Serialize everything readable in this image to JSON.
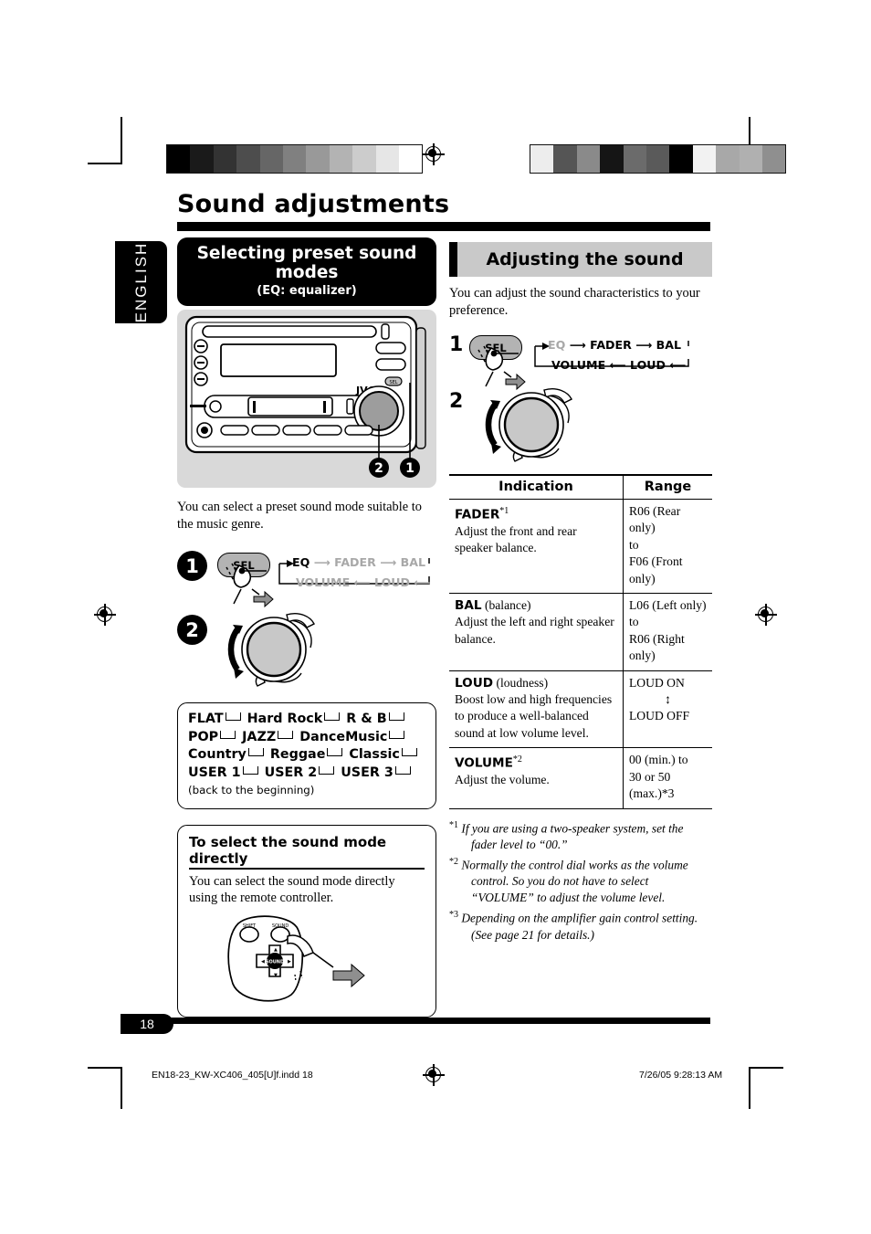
{
  "page": {
    "title": "Sound adjustments",
    "language_tab": "ENGLISH",
    "number": "18"
  },
  "left_column": {
    "header": {
      "title": "Selecting preset sound modes",
      "subtitle": "(EQ: equalizer)"
    },
    "unit_illustration": {
      "brand": "JVC",
      "callout_dial": "2",
      "callout_sel": "1"
    },
    "intro": "You can select a preset sound mode suitable to the music genre.",
    "step1": {
      "number": "1",
      "button_label": "SEL",
      "flow_top": [
        "EQ",
        "FADER",
        "BAL"
      ],
      "flow_bottom": [
        "VOLUME",
        "LOUD"
      ],
      "active": "EQ"
    },
    "step2": {
      "number": "2"
    },
    "mode_list": {
      "row1": [
        "FLAT",
        "Hard Rock",
        "R & B"
      ],
      "row2": [
        "POP",
        "JAZZ",
        "DanceMusic"
      ],
      "row3": [
        "Country",
        "Reggae",
        "Classic"
      ],
      "row4": [
        "USER 1",
        "USER 2",
        "USER 3"
      ],
      "footer": "(back to the beginning)"
    },
    "direct_select": {
      "heading": "To select the sound mode directly",
      "text": "You can select the sound mode directly using the remote controller.",
      "remote_buttons": [
        "SHIFT",
        "SOUND",
        "SOUND"
      ]
    }
  },
  "right_column": {
    "header": {
      "title": "Adjusting the sound"
    },
    "intro": "You can adjust the sound characteristics to your preference.",
    "step1": {
      "number": "1",
      "button_label": "SEL",
      "flow_top": [
        "EQ",
        "FADER",
        "BAL"
      ],
      "flow_bottom": [
        "VOLUME",
        "LOUD"
      ],
      "dimmed": "EQ"
    },
    "step2": {
      "number": "2"
    },
    "table": {
      "columns": [
        "Indication",
        "Range"
      ],
      "rows": [
        {
          "indication_name": "FADER",
          "indication_sup": "*1",
          "indication_suffix": "",
          "indication_desc": "Adjust the front and rear speaker balance.",
          "range_lines": [
            "R06 (Rear only)",
            "to",
            "F06 (Front only)"
          ],
          "range_arrow": false
        },
        {
          "indication_name": "BAL",
          "indication_sup": "",
          "indication_suffix": " (balance)",
          "indication_desc": "Adjust the left and right speaker balance.",
          "range_lines": [
            "L06 (Left only)",
            "to",
            "R06 (Right only)"
          ],
          "range_arrow": false
        },
        {
          "indication_name": "LOUD",
          "indication_sup": "",
          "indication_suffix": " (loudness)",
          "indication_desc": "Boost low and high frequencies to produce a well-balanced sound at low volume level.",
          "range_lines": [
            "LOUD ON",
            "↕",
            "LOUD OFF"
          ],
          "range_arrow": true
        },
        {
          "indication_name": "VOLUME",
          "indication_sup": "*2",
          "indication_suffix": "",
          "indication_desc": "Adjust the volume.",
          "range_lines": [
            "00 (min.) to",
            "30 or 50 (max.)*3"
          ],
          "range_arrow": false
        }
      ]
    },
    "notes": [
      {
        "marker": "*1",
        "text": "If you are using a two-speaker system, set the fader level to “00.”"
      },
      {
        "marker": "*2",
        "text": "Normally the control dial works as the volume control. So you do not have to select “VOLUME” to adjust the volume level."
      },
      {
        "marker": "*3",
        "text": "Depending on the amplifier gain control setting. (See page 21 for details.)"
      }
    ]
  },
  "footer": {
    "filename": "EN18-23_KW-XC406_405[U]f.indd   18",
    "timestamp": "7/26/05   9:28:13 AM"
  },
  "colors": {
    "black": "#000000",
    "header_grey": "#c9c9c9",
    "panel_grey": "#d9d9d9",
    "dim_text": "#a8a8a8"
  }
}
